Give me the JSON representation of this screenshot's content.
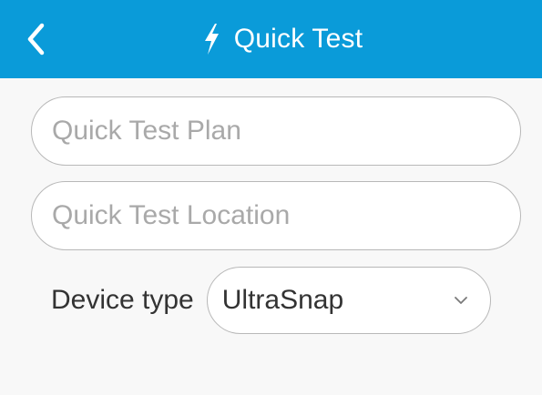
{
  "header": {
    "title": "Quick Test",
    "back_icon": "chevron-left-icon",
    "title_icon": "lightning-bolt-icon",
    "background": "#0a9bd9"
  },
  "form": {
    "plan": {
      "value": "",
      "placeholder": "Quick Test Plan"
    },
    "location": {
      "value": "",
      "placeholder": "Quick Test Location"
    },
    "device_type": {
      "label": "Device type",
      "selected": "UltraSnap",
      "icon": "chevron-down-icon"
    }
  }
}
